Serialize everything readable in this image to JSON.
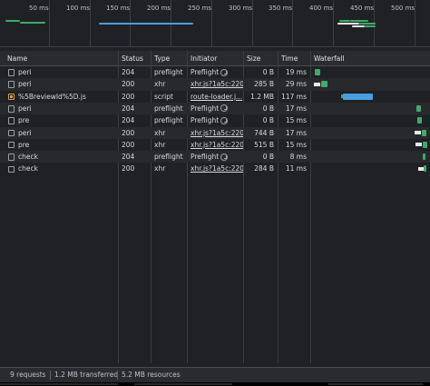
{
  "overview": {
    "ticks": [
      "50 ms",
      "100 ms",
      "150 ms",
      "200 ms",
      "250 ms",
      "300 ms",
      "350 ms",
      "400 ms",
      "450 ms",
      "500 ms"
    ]
  },
  "columns": {
    "name": "Name",
    "status": "Status",
    "type": "Type",
    "initiator": "Initiator",
    "size": "Size",
    "time": "Time",
    "waterfall": "Waterfall"
  },
  "requests": [
    {
      "name": "peri",
      "status": "204",
      "type": "preflight",
      "initiator": "Preflight",
      "initiator_kind": "preflight",
      "size": "0 B",
      "time": "19 ms",
      "icon": "document-icon"
    },
    {
      "name": "peri",
      "status": "200",
      "type": "xhr",
      "initiator": "xhr.js?1a5c:220",
      "initiator_kind": "link",
      "size": "285 B",
      "time": "29 ms",
      "icon": "document-icon"
    },
    {
      "name": "%5BreviewId%5D.js",
      "status": "200",
      "type": "script",
      "initiator": "route-loader.j...",
      "initiator_kind": "link",
      "size": "1.2 MB",
      "time": "117 ms",
      "icon": "script-file-icon"
    },
    {
      "name": "peri",
      "status": "204",
      "type": "preflight",
      "initiator": "Preflight",
      "initiator_kind": "preflight",
      "size": "0 B",
      "time": "17 ms",
      "icon": "document-icon"
    },
    {
      "name": "pre",
      "status": "204",
      "type": "preflight",
      "initiator": "Preflight",
      "initiator_kind": "preflight",
      "size": "0 B",
      "time": "15 ms",
      "icon": "document-icon"
    },
    {
      "name": "peri",
      "status": "200",
      "type": "xhr",
      "initiator": "xhr.js?1a5c:220",
      "initiator_kind": "link",
      "size": "744 B",
      "time": "17 ms",
      "icon": "document-icon"
    },
    {
      "name": "pre",
      "status": "200",
      "type": "xhr",
      "initiator": "xhr.js?1a5c:220",
      "initiator_kind": "link",
      "size": "515 B",
      "time": "15 ms",
      "icon": "document-icon"
    },
    {
      "name": "check",
      "status": "204",
      "type": "preflight",
      "initiator": "Preflight",
      "initiator_kind": "preflight",
      "size": "0 B",
      "time": "8 ms",
      "icon": "document-icon"
    },
    {
      "name": "check",
      "status": "200",
      "type": "xhr",
      "initiator": "xhr.js?1a5c:220",
      "initiator_kind": "link",
      "size": "284 B",
      "time": "11 ms",
      "icon": "document-icon"
    }
  ],
  "statusbar": {
    "requests": "9 requests",
    "transferred": "1.2 MB transferred",
    "resources": "5.2 MB resources"
  },
  "colors": {
    "background": "#202124",
    "header": "#2a2b2e",
    "waterfall_green": "#3dab6b",
    "waterfall_blue": "#4a9ee0",
    "waiting_white": "#e8eaed"
  }
}
